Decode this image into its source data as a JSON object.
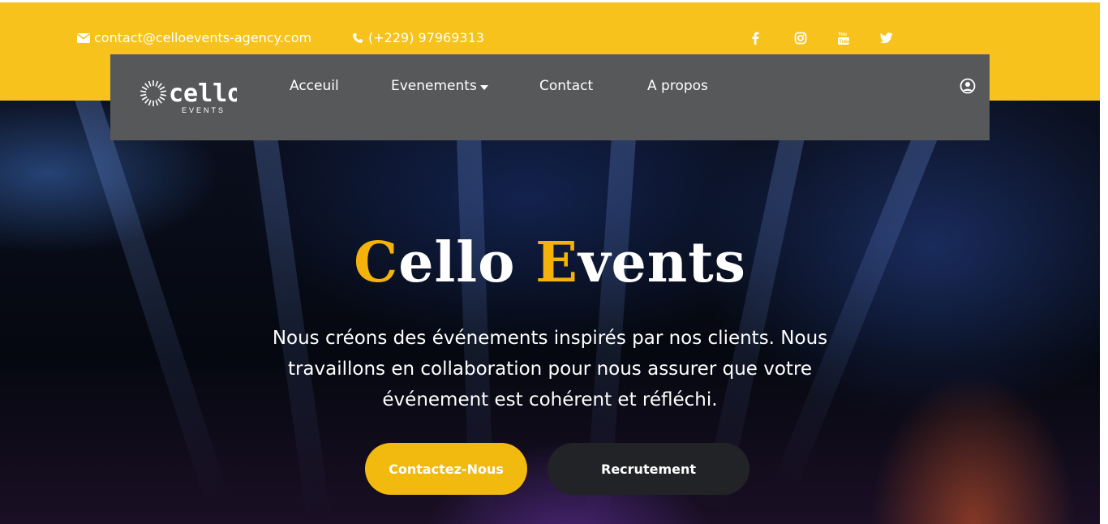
{
  "topbar": {
    "email": "contact@celloevents-agency.com",
    "phone": "(+229) 97969313",
    "socials": [
      {
        "name": "facebook",
        "glyph": "f"
      },
      {
        "name": "instagram",
        "glyph": "instagram"
      },
      {
        "name": "youtube",
        "glyph": "You"
      },
      {
        "name": "twitter",
        "glyph": "twitter"
      }
    ],
    "colors": {
      "background": "#f7c21b",
      "text": "#ffffff"
    }
  },
  "navbar": {
    "logo_text": "cello",
    "logo_sub": "EVENTS",
    "items": [
      {
        "label": "Acceuil"
      },
      {
        "label": "Evenements"
      },
      {
        "label": "Contact"
      },
      {
        "label": "A propos"
      }
    ],
    "background": "#575859"
  },
  "hero": {
    "title_c": "C",
    "title_rest1": "ello ",
    "title_e": "E",
    "title_rest2": "vents",
    "description": "Nous créons des événements inspirés par nos clients. Nous travaillons en collaboration pour nous assurer que votre événement est cohérent et réfléchi.",
    "primary_button": "Contactez-Nous",
    "secondary_button": "Recrutement",
    "accent_color": "#f5b20a"
  }
}
